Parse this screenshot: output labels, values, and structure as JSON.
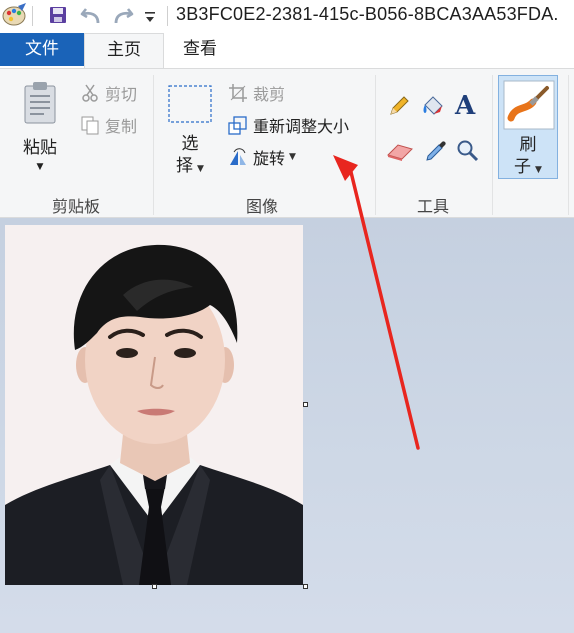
{
  "window": {
    "title": "3B3FC0E2-2381-415c-B056-8BCA3AA53FDA."
  },
  "tabs": {
    "file": "文件",
    "home": "主页",
    "view": "查看"
  },
  "ribbon": {
    "clipboard": {
      "group_label": "剪贴板",
      "paste": "粘贴",
      "cut": "剪切",
      "copy": "复制"
    },
    "image": {
      "group_label": "图像",
      "select_line1": "选",
      "select_line2": "择",
      "crop": "裁剪",
      "resize": "重新调整大小",
      "rotate": "旋转"
    },
    "tools": {
      "group_label": "工具",
      "items": [
        "pencil-icon",
        "fill-bucket-icon",
        "text-icon",
        "eraser-icon",
        "color-picker-icon",
        "magnifier-icon"
      ]
    },
    "brushes": {
      "line1": "刷",
      "line2": "子"
    }
  },
  "colors": {
    "file_tab": "#1a63b8",
    "ribbon_bg": "#f5f6f7",
    "workspace_bg": "#c9d3e2",
    "annotation_arrow": "#e8261f"
  }
}
